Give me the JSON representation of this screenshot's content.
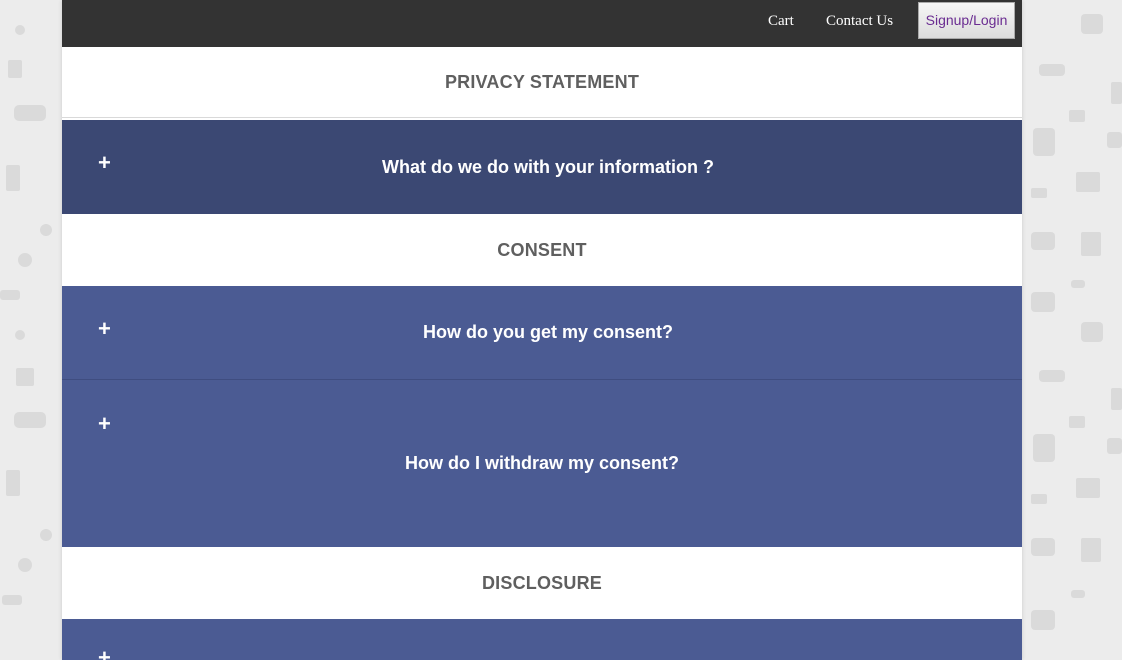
{
  "nav": {
    "cart": "Cart",
    "contact": "Contact Us",
    "signup": "Signup/Login"
  },
  "sections": {
    "privacy_title": "PRIVACY STATEMENT",
    "consent_title": "CONSENT",
    "disclosure_title": "DISCLOSURE"
  },
  "accordions": {
    "info": {
      "icon": "plus-icon",
      "symbol": "+",
      "title": "What do we do with your information ?"
    },
    "get_consent": {
      "icon": "plus-icon",
      "symbol": "+",
      "title": "How do you get my consent?"
    },
    "withdraw_consent": {
      "icon": "plus-icon",
      "symbol": "+",
      "title": "How do I withdraw my consent?"
    },
    "disclosure_item": {
      "icon": "plus-icon",
      "symbol": "+",
      "title": ""
    }
  },
  "colors": {
    "topbar": "#333333",
    "accordion": "#4b5b93",
    "accordion_active": "#3b4873",
    "section_text": "#5f5f5f",
    "background": "#ececec"
  }
}
